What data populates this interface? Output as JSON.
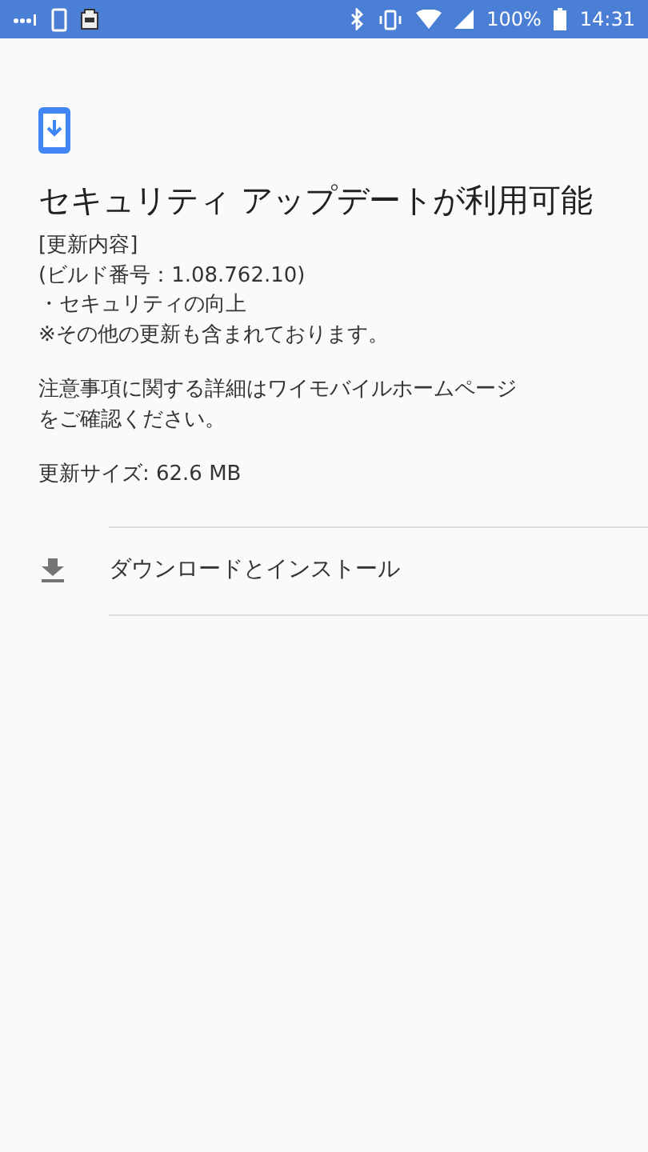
{
  "status_bar": {
    "battery": "100%",
    "time": "14:31"
  },
  "title": "セキュリティ アップデートが利用可能",
  "details": [
    "[更新内容]",
    "(ビルド番号：1.08.762.10)",
    "・セキュリティの向上",
    "※その他の更新も含まれております。"
  ],
  "notice": [
    "注意事項に関する詳細はワイモバイルホームページ",
    "をご確認ください。"
  ],
  "size": "更新サイズ: 62.6 MB",
  "action": {
    "label": "ダウンロードとインストール"
  }
}
